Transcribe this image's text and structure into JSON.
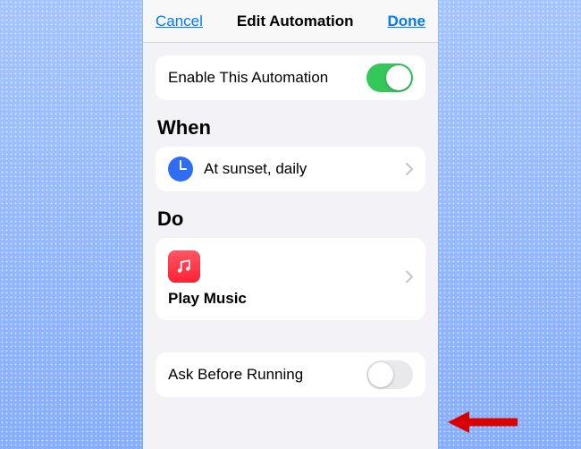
{
  "navbar": {
    "cancel": "Cancel",
    "title": "Edit Automation",
    "done": "Done"
  },
  "enable_row": {
    "label": "Enable This Automation",
    "toggle_on": true
  },
  "sections": {
    "when": "When",
    "do": "Do"
  },
  "when_row": {
    "icon": "clock-icon",
    "text": "At sunset, daily"
  },
  "do_card": {
    "app_icon": "music-app-icon",
    "action": "Play Music"
  },
  "ask_row": {
    "label": "Ask Before Running",
    "toggle_on": false
  },
  "colors": {
    "accent_blue": "#007aff",
    "toggle_green": "#34c759"
  }
}
